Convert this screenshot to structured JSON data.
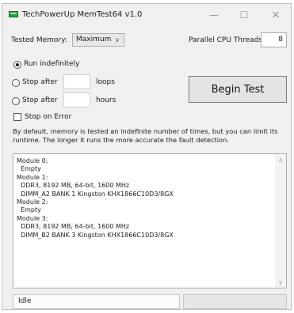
{
  "window": {
    "title": "TechPowerUp MemTest64 v1.0",
    "icon": "memory-chip-icon"
  },
  "titlebar_buttons": {
    "minimize": "—",
    "maximize": "☐",
    "close": "✕"
  },
  "tested_memory": {
    "label": "Tested Memory:",
    "value": "Maximum",
    "chevron": "∨"
  },
  "threads": {
    "label": "Parallel CPU Threads:",
    "value": "8"
  },
  "run_options": {
    "run_indefinitely": "Run indefinitely",
    "stop_after": "Stop after",
    "loops": "loops",
    "hours": "hours",
    "selected": "run_indefinitely"
  },
  "begin_button": "Begin Test",
  "stop_on_error": {
    "label": "Stop on Error",
    "checked": false
  },
  "description": "By default, memory is tested an indefinite number of times, but you can limit its runtime. The longer it runs the more accurate the fault detection.",
  "modules_text": [
    "Module 0:",
    "  Empty",
    "Module 1:",
    "  DDR3, 8192 MB, 64-bit, 1600 MHz",
    "  DIMM_A2 BANK 1 Kingston KHX1866C10D3/8GX",
    "Module 2:",
    "  Empty",
    "Module 3:",
    "  DDR3, 8192 MB, 64-bit, 1600 MHz",
    "  DIMM_B2 BANK 3 Kingston KHX1866C10D3/8GX"
  ],
  "scroll": {
    "up": "∧",
    "down": "∨"
  },
  "status": {
    "text": "Idle",
    "progress": 0
  }
}
